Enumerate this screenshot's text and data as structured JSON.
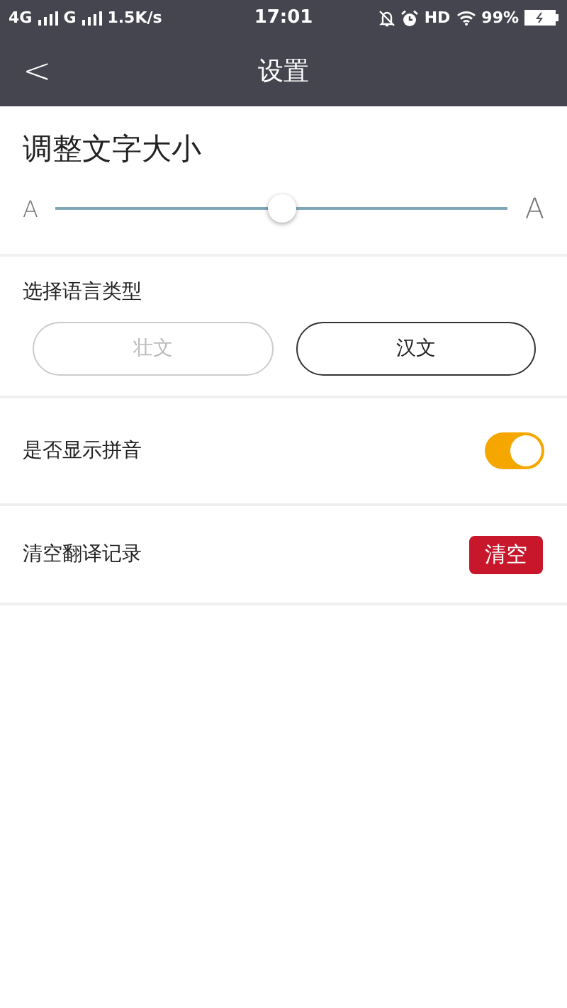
{
  "status_bar": {
    "network_1": "4G",
    "network_2": "G",
    "speed": "1.5K/s",
    "time": "17:01",
    "hd": "HD",
    "battery": "99%"
  },
  "header": {
    "title": "设置",
    "back": "<"
  },
  "font_size": {
    "title": "调整文字大小",
    "small_label": "A",
    "large_label": "A",
    "level": 0.5
  },
  "language": {
    "title": "选择语言类型",
    "options": [
      {
        "label": "壮文",
        "selected": false
      },
      {
        "label": "汉文",
        "selected": true
      }
    ]
  },
  "pinyin": {
    "label": "是否显示拼音",
    "on": true
  },
  "clear": {
    "label": "清空翻译记录",
    "button": "清空"
  }
}
